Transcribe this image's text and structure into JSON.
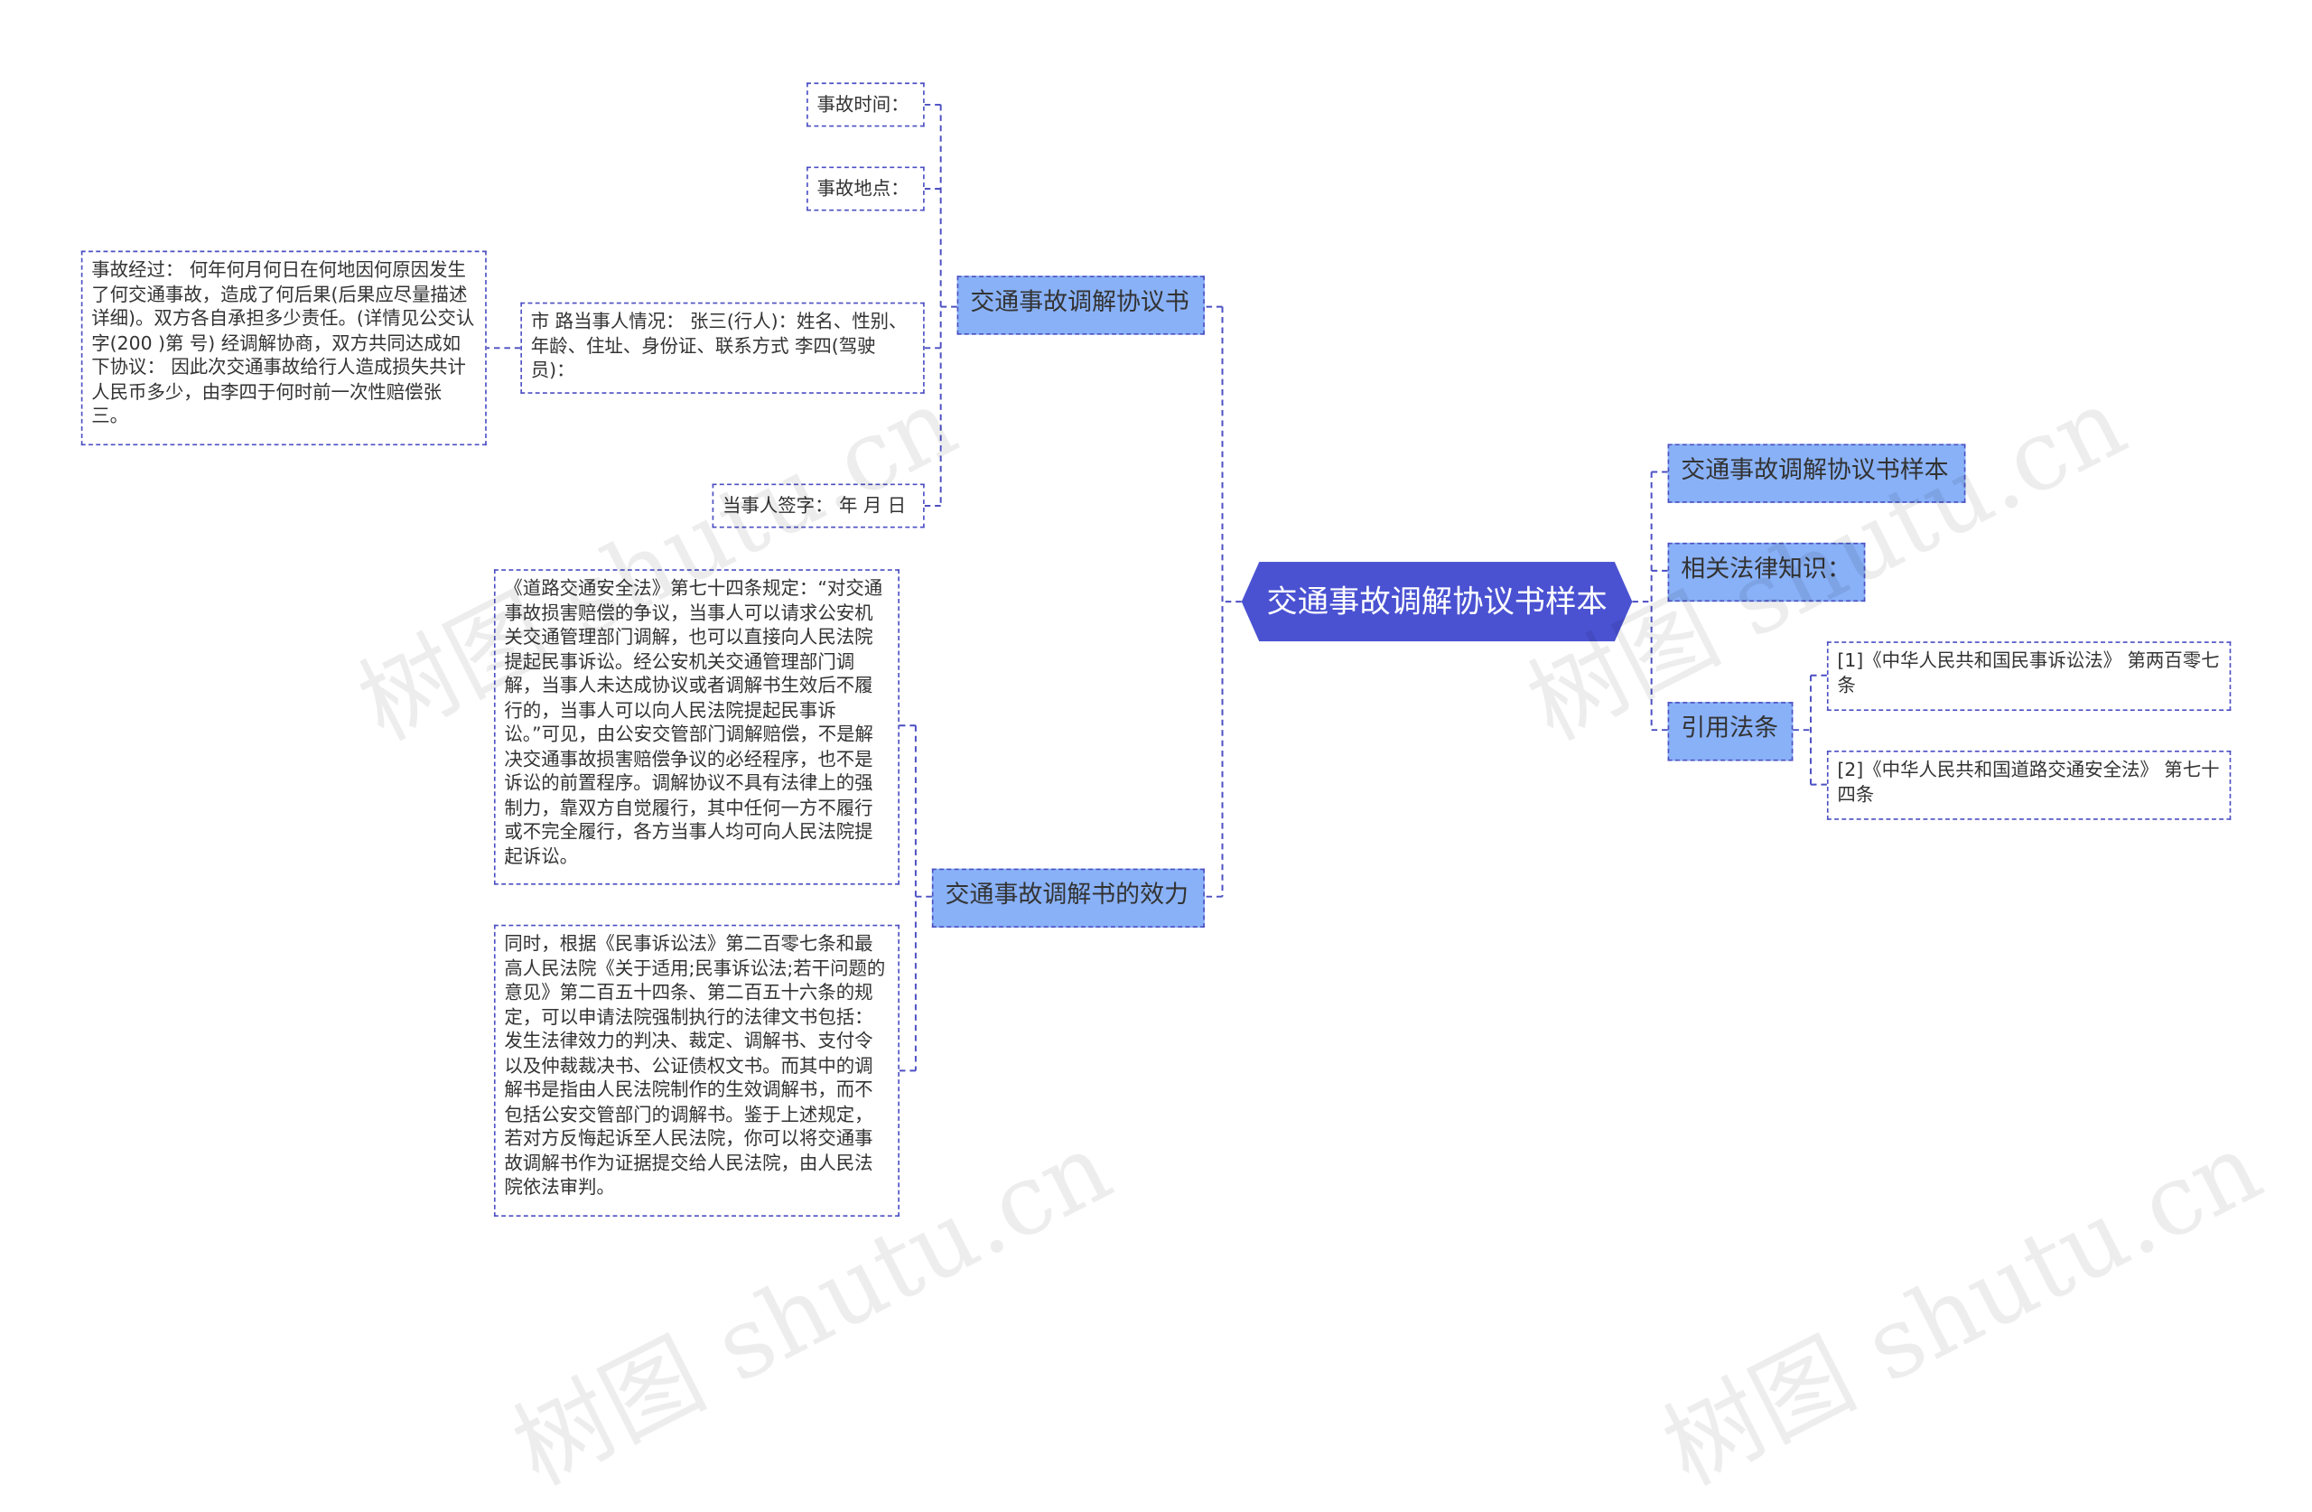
{
  "root": "交通事故调解协议书样本",
  "branches": {
    "agreement": "交通事故调解协议书",
    "effect": "交通事故调解书的效力",
    "sample": "交通事故调解协议书样本",
    "legal": "相关法律知识：",
    "cite": "引用法条"
  },
  "leaves": {
    "time": "事故时间：",
    "place": "事故地点：",
    "parties": "市 路当事人情况： 张三(行人)：姓名、性别、年龄、住址、身份证、联系方式 李四(驾驶员)：",
    "process": "事故经过： 何年何月何日在何地因何原因发生了何交通事故，造成了何后果(后果应尽量描述详细)。双方各自承担多少责任。(详情见公交认字(200 )第 号) 经调解协商，双方共同达成如下协议： 因此次交通事故给行人造成损失共计人民币多少，由李四于何时前一次性赔偿张三。",
    "sign": "当事人签字： 年 月 日",
    "effect1": "《道路交通安全法》第七十四条规定：“对交通事故损害赔偿的争议，当事人可以请求公安机关交通管理部门调解，也可以直接向人民法院提起民事诉讼。经公安机关交通管理部门调解，当事人未达成协议或者调解书生效后不履行的，当事人可以向人民法院提起民事诉讼。”可见，由公安交管部门调解赔偿，不是解决交通事故损害赔偿争议的必经程序，也不是诉讼的前置程序。调解协议不具有法律上的强制力，靠双方自觉履行，其中任何一方不履行或不完全履行，各方当事人均可向人民法院提起诉讼。",
    "effect2": "同时，根据《民事诉讼法》第二百零七条和最高人民法院《关于适用;民事诉讼法;若干问题的意见》第二百五十四条、第二百五十六条的规定，可以申请法院强制执行的法律文书包括：发生法律效力的判决、裁定、调解书、支付令以及仲裁裁决书、公证债权文书。而其中的调解书是指由人民法院制作的生效调解书，而不包括公安交管部门的调解书。鉴于上述规定，若对方反悔起诉至人民法院，你可以将交通事故调解书作为证据提交给人民法院，由人民法院依法审判。",
    "cite1": "[1]《中华人民共和国民事诉讼法》 第两百零七条",
    "cite2": "[2]《中华人民共和国道路交通安全法》 第七十四条"
  },
  "watermark": "树图 shutu.cn",
  "colors": {
    "root": "#4a52d2",
    "branch": "#89b1f7",
    "line": "#4b4fc2"
  }
}
